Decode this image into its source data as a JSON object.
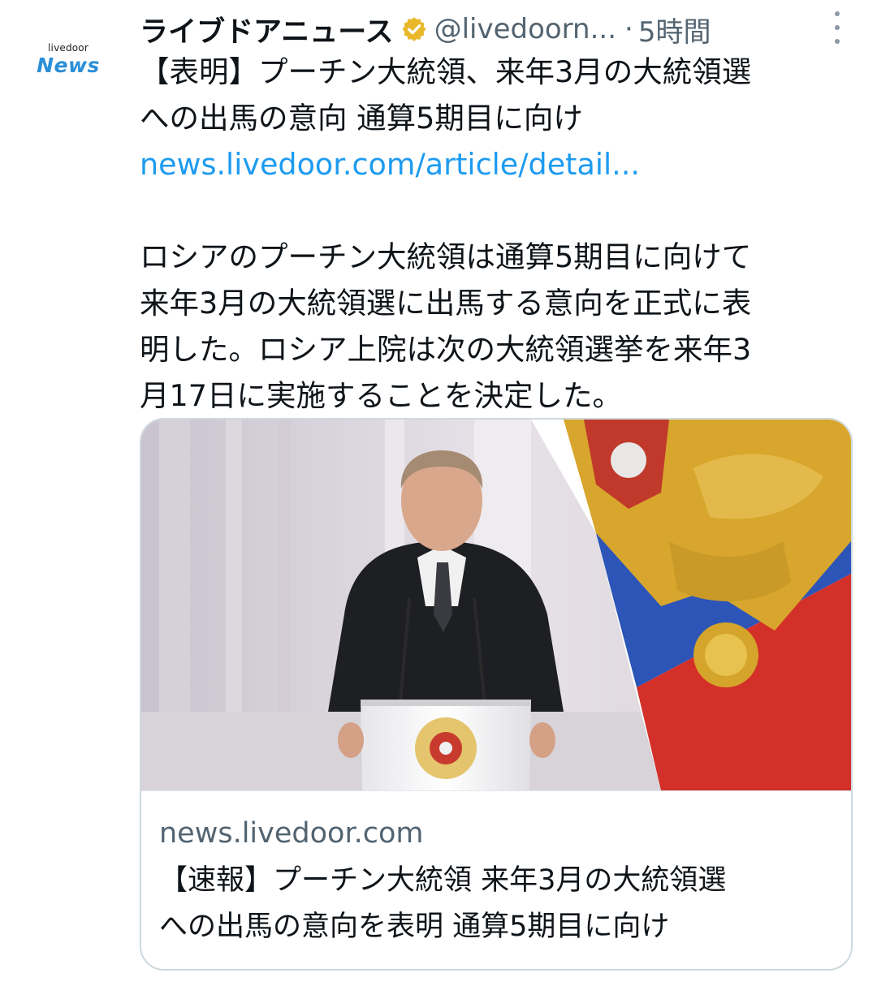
{
  "account": {
    "avatar_brand_small": "livedoor",
    "avatar_brand_big": "News",
    "display_name": "ライブドアニュース",
    "handle": "@livedoorn...",
    "separator": "·",
    "timestamp": "5時間",
    "verified_color": "#e8b82a"
  },
  "tweet": {
    "line1": "【表明】プーチン大統領、来年3月の大統領選",
    "line2": "への出馬の意向 通算5期目に向け",
    "link": "news.livedoor.com/article/detail...",
    "body1": "ロシアのプーチン大統領は通算5期目に向けて",
    "body2": "来年3月の大統領選に出馬する意向を正式に表",
    "body3": "明した。ロシア上院は次の大統領選挙を来年3",
    "body4": "月17日に実施することを決定した。"
  },
  "card": {
    "domain": "news.livedoor.com",
    "title1": "【速報】プーチン大統領 来年3月の大統領選",
    "title2": "への出馬の意向を表明 通算5期目に向け"
  },
  "colors": {
    "link": "#1d9bf0",
    "muted": "#536471",
    "text": "#0f1419",
    "brand_blue": "#2c8fd6"
  }
}
